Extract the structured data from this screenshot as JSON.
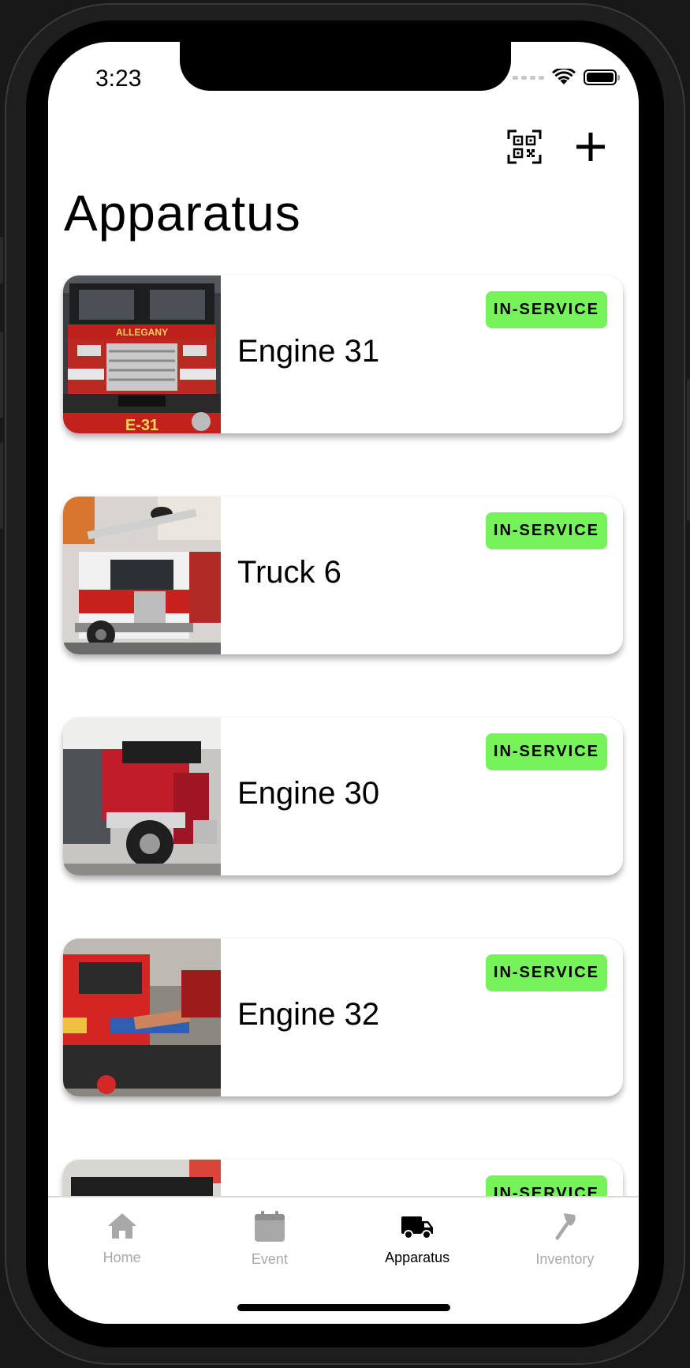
{
  "status": {
    "time": "3:23"
  },
  "header": {
    "title": "Apparatus",
    "scan_icon": "qr-code-icon",
    "add_icon": "plus-icon"
  },
  "apparatus": [
    {
      "name": "Engine 31",
      "status": "IN-SERVICE",
      "photo_text": "ALLEGANY",
      "plate": "E-31"
    },
    {
      "name": "Truck 6",
      "status": "IN-SERVICE"
    },
    {
      "name": "Engine 30",
      "status": "IN-SERVICE"
    },
    {
      "name": "Engine 32",
      "status": "IN-SERVICE"
    },
    {
      "name": "",
      "status": "IN-SERVICE"
    }
  ],
  "tabbar": {
    "tabs": [
      {
        "label": "Home",
        "icon": "home-icon",
        "active": false
      },
      {
        "label": "Event",
        "icon": "calendar-icon",
        "active": false
      },
      {
        "label": "Apparatus",
        "icon": "truck-icon",
        "active": true
      },
      {
        "label": "Inventory",
        "icon": "axe-icon",
        "active": false
      }
    ]
  },
  "colors": {
    "badge": "#76f25a",
    "inactive_tab": "#a8a8a8",
    "active_tab": "#000000"
  }
}
